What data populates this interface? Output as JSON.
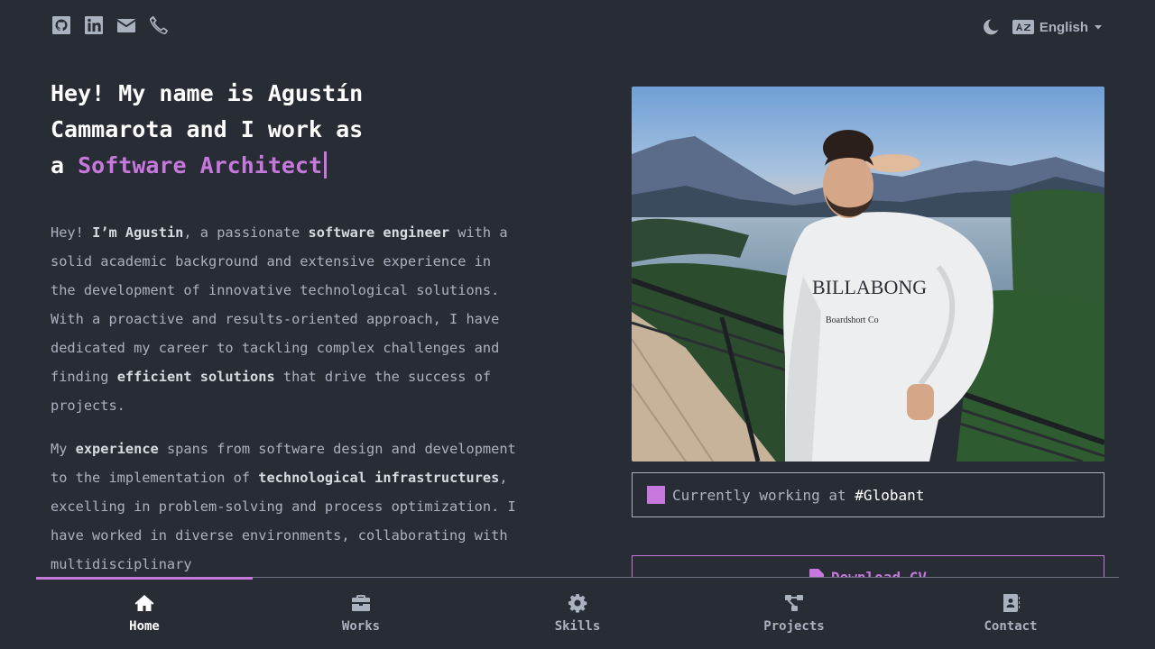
{
  "header": {
    "social_icons": [
      "github-icon",
      "linkedin-icon",
      "email-icon",
      "phone-icon"
    ],
    "theme_icon": "moon-icon",
    "language_icon": "language-icon",
    "language_label": "English"
  },
  "hero": {
    "line1": "Hey! My name is Agustín",
    "line2": "Cammarota and I work as",
    "prefix": "a ",
    "role": "Software Architect"
  },
  "about": {
    "p1": [
      {
        "t": "Hey! ",
        "b": false
      },
      {
        "t": "I’m Agustin",
        "b": true
      },
      {
        "t": ", a passionate ",
        "b": false
      },
      {
        "t": "software engineer",
        "b": true
      },
      {
        "t": " with a solid academic background and extensive experience in the development of innovative technological solutions. With a proactive and results-oriented approach, I have dedicated my career to tackling complex challenges and finding ",
        "b": false
      },
      {
        "t": "efficient solutions",
        "b": true
      },
      {
        "t": " that drive the success of projects.",
        "b": false
      }
    ],
    "p2": [
      {
        "t": "My ",
        "b": false
      },
      {
        "t": "experience",
        "b": true
      },
      {
        "t": " spans from software design and development to the implementation of ",
        "b": false
      },
      {
        "t": "technological infrastructures",
        "b": true
      },
      {
        "t": ", excelling in problem-solving and process optimization. I have worked in diverse environments, collaborating with multidisciplinary",
        "b": false
      }
    ]
  },
  "working": {
    "label": "Currently working at ",
    "company": "#Globant"
  },
  "cv_button": {
    "label": "Download CV"
  },
  "nav": {
    "items": [
      {
        "label": "Home",
        "icon": "home-icon"
      },
      {
        "label": "Works",
        "icon": "briefcase-icon"
      },
      {
        "label": "Skills",
        "icon": "gear-icon"
      },
      {
        "label": "Projects",
        "icon": "diagram-icon"
      },
      {
        "label": "Contact",
        "icon": "contact-card-icon"
      }
    ],
    "active_index": 0
  },
  "colors": {
    "background": "#282c34",
    "accent": "#c678dd",
    "text": "#abb2bf"
  }
}
